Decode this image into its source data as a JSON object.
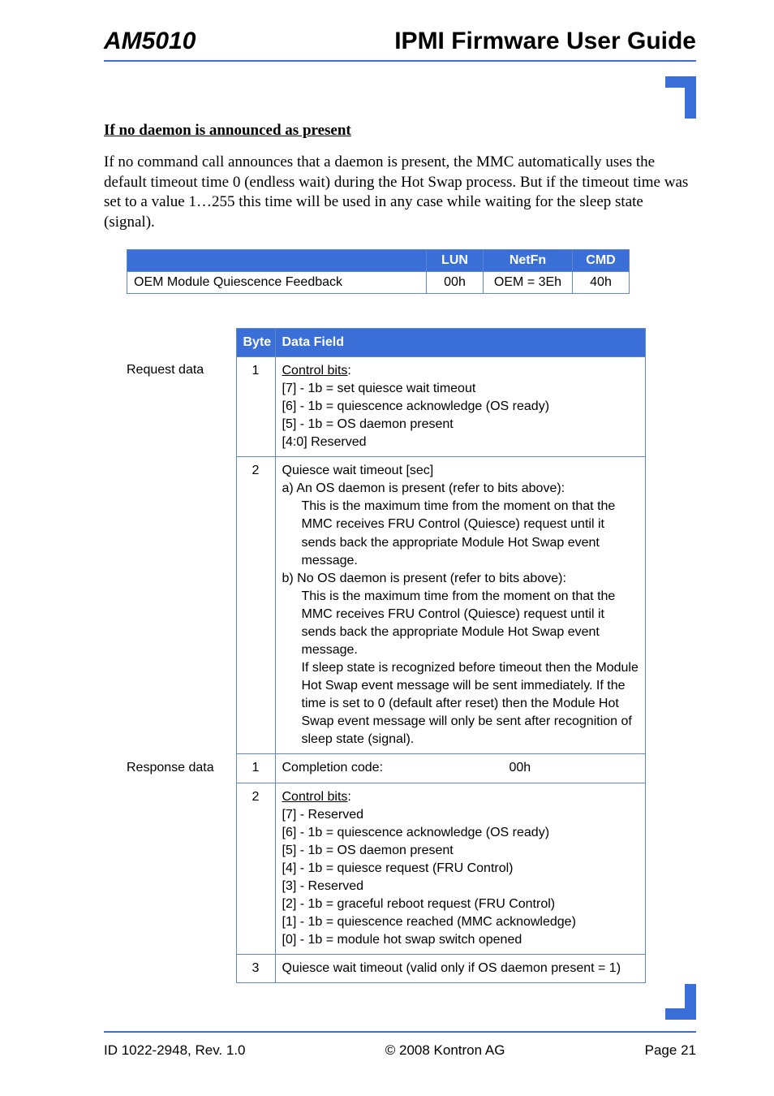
{
  "header": {
    "left": "AM5010",
    "right": "IPMI Firmware User Guide"
  },
  "section": {
    "title": "If no daemon is announced as present",
    "paragraph": "If no command call announces that a daemon is present, the MMC automatically uses the default timeout time 0 (endless wait) during the Hot Swap process. But if the timeout time was set to a value 1…255 this time will be used in any case while waiting for the sleep state (signal)."
  },
  "table1": {
    "headers": {
      "lun": "LUN",
      "netfn": "NetFn",
      "cmd": "CMD"
    },
    "row": {
      "name": "OEM Module Quiescence Feedback",
      "lun": "00h",
      "netfn": "OEM = 3Eh",
      "cmd": "40h"
    }
  },
  "table2": {
    "headers": {
      "byte": "Byte",
      "data": "Data Field"
    },
    "rows": [
      {
        "label": "Request data",
        "byte": "1",
        "lines": [
          {
            "text": "Control bits",
            "underline": true,
            "trailing_colon": true
          },
          {
            "text": "[7] - 1b = set quiesce wait timeout"
          },
          {
            "text": "[6] - 1b = quiescence acknowledge (OS ready)"
          },
          {
            "text": "[5] - 1b = OS daemon present"
          },
          {
            "text": "[4:0] Reserved"
          }
        ]
      },
      {
        "label": "",
        "byte": "2",
        "lines": [
          {
            "text": "Quiesce wait timeout [sec]"
          },
          {
            "text": "a) An OS daemon is present (refer to bits above):"
          },
          {
            "text": "This is the maximum time from the moment on that the MMC receives FRU Control (Quiesce) request until it sends back the appropriate Module Hot Swap event message.",
            "indent": true
          },
          {
            "text": "b) No OS daemon is present (refer to bits above):"
          },
          {
            "text": "This is the maximum time from the moment on that the MMC receives FRU Control (Quiesce) request until it sends back the appropriate Module Hot Swap event message.",
            "indent": true
          },
          {
            "text": "If sleep state is recognized before timeout then the Module Hot Swap event message will be sent immediately. If the time is set to 0 (default after reset) then the Module Hot Swap event message will only be sent after recognition of sleep state (signal).",
            "indent": true
          }
        ]
      },
      {
        "label": "Response data",
        "byte": "1",
        "completion": {
          "left": "Completion code:",
          "right": "00h"
        }
      },
      {
        "label": "",
        "byte": "2",
        "lines": [
          {
            "text": "Control bits",
            "underline": true,
            "trailing_colon": true
          },
          {
            "text": "[7] - Reserved"
          },
          {
            "text": "[6] - 1b = quiescence acknowledge (OS ready)"
          },
          {
            "text": "[5] - 1b = OS daemon present"
          },
          {
            "text": "[4] - 1b = quiesce request (FRU Control)"
          },
          {
            "text": "[3] - Reserved"
          },
          {
            "text": "[2] - 1b = graceful reboot request (FRU Control)"
          },
          {
            "text": "[1] - 1b = quiescence reached (MMC acknowledge)"
          },
          {
            "text": "[0] - 1b = module hot swap switch opened"
          }
        ]
      },
      {
        "label": "",
        "byte": "3",
        "lines": [
          {
            "text": "Quiesce wait timeout (valid only if OS daemon present = 1)"
          }
        ]
      }
    ]
  },
  "footer": {
    "left": "ID 1022-2948, Rev. 1.0",
    "center": "© 2008 Kontron AG",
    "right": "Page 21"
  }
}
